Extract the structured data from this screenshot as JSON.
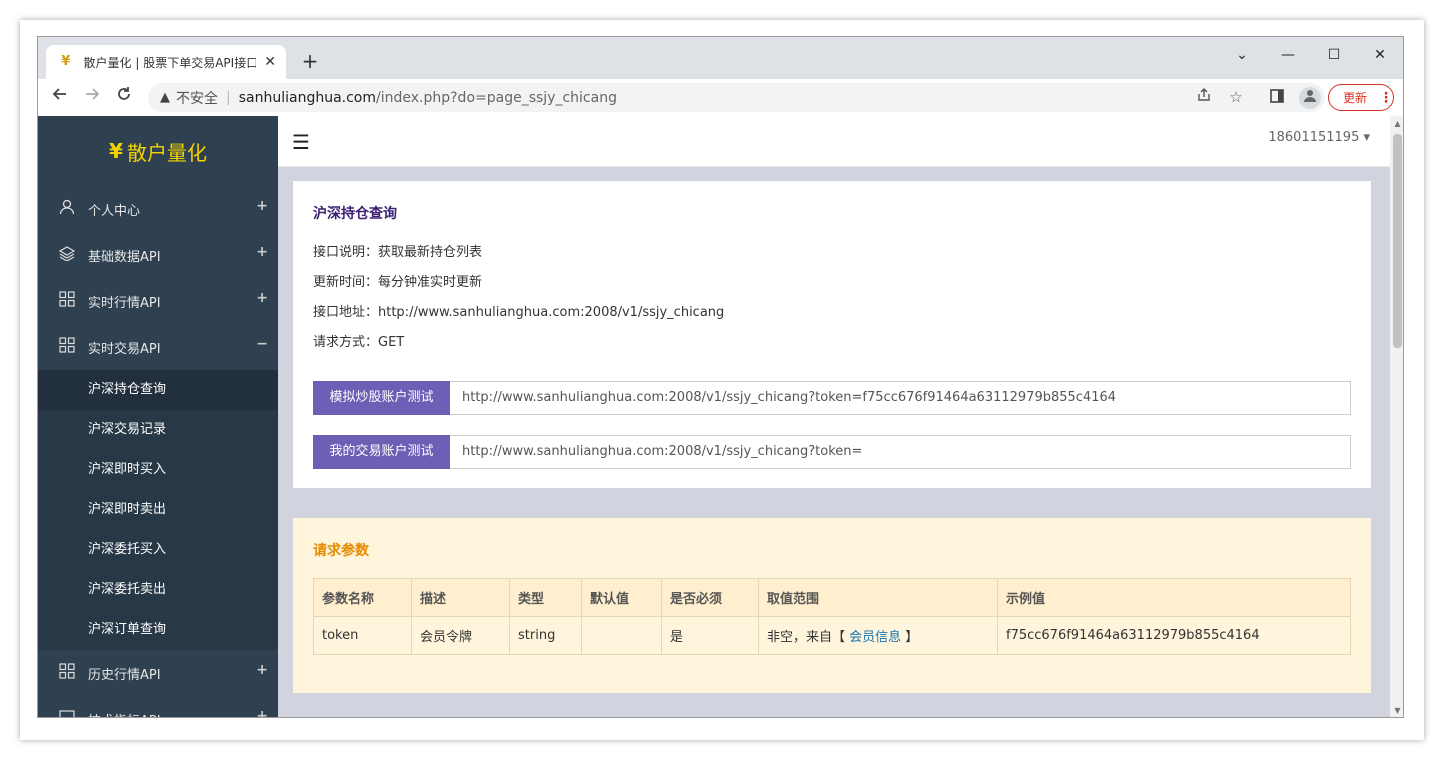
{
  "browser": {
    "tab_favicon": "¥",
    "tab_title": "散户量化 | 股票下单交易API接口",
    "tab_close": "✕",
    "new_tab": "+",
    "window_controls": {
      "minimize": "—",
      "maximize": "☐",
      "close": "✕",
      "tablist": "⌄"
    },
    "url_warning_icon": "▲",
    "url_insecure_label": "不安全",
    "url_separator": "|",
    "url_host": "sanhulianghua.com",
    "url_path": "/index.php?do=page_ssjy_chicang",
    "update_label": "更新",
    "update_menu": "⋮"
  },
  "sidebar": {
    "brand_symbol": "¥",
    "brand_name": "散户量化",
    "items": [
      {
        "label": "个人中心",
        "icon": "user-icon",
        "toggle": "+"
      },
      {
        "label": "基础数据API",
        "icon": "layers-icon",
        "toggle": "+"
      },
      {
        "label": "实时行情API",
        "icon": "grid-icon",
        "toggle": "+"
      },
      {
        "label": "实时交易API",
        "icon": "grid-icon",
        "toggle": "−"
      }
    ],
    "subitems": [
      "沪深持仓查询",
      "沪深交易记录",
      "沪深即时买入",
      "沪深即时卖出",
      "沪深委托买入",
      "沪深委托卖出",
      "沪深订单查询"
    ],
    "items_after": [
      {
        "label": "历史行情API",
        "icon": "grid-icon",
        "toggle": "+"
      },
      {
        "label": "技术指标API",
        "icon": "chart-icon",
        "toggle": "+"
      }
    ]
  },
  "topbar": {
    "menu_icon": "☰",
    "user_label": "18601151195 ▾"
  },
  "api_card": {
    "title": "沪深持仓查询",
    "lines": [
      "接口说明：获取最新持仓列表",
      "更新时间：每分钟准实时更新",
      "接口地址：http://www.sanhulianghua.com:2008/v1/ssjy_chicang",
      "请求方式：GET"
    ],
    "tests": [
      {
        "button": "模拟炒股账户测试",
        "url": "http://www.sanhulianghua.com:2008/v1/ssjy_chicang?token=f75cc676f91464a63112979b855c4164"
      },
      {
        "button": "我的交易账户测试",
        "url": "http://www.sanhulianghua.com:2008/v1/ssjy_chicang?token="
      }
    ]
  },
  "params_card": {
    "title": "请求参数",
    "headers": [
      "参数名称",
      "描述",
      "类型",
      "默认值",
      "是否必须",
      "取值范围",
      "示例值"
    ],
    "row": {
      "name": "token",
      "desc": "会员令牌",
      "type": "string",
      "default": "",
      "required": "是",
      "range_prefix": "非空，来自【 ",
      "range_link": "会员信息",
      "range_suffix": " 】",
      "example": "f75cc676f91464a63112979b855c4164"
    }
  },
  "colors": {
    "sidebar_bg": "#2f4050",
    "brand": "#f3d300",
    "accent_button": "#6c5fb5",
    "params_bg": "#fff4dc",
    "params_title": "#e68a00",
    "update_red": "#d93025"
  }
}
